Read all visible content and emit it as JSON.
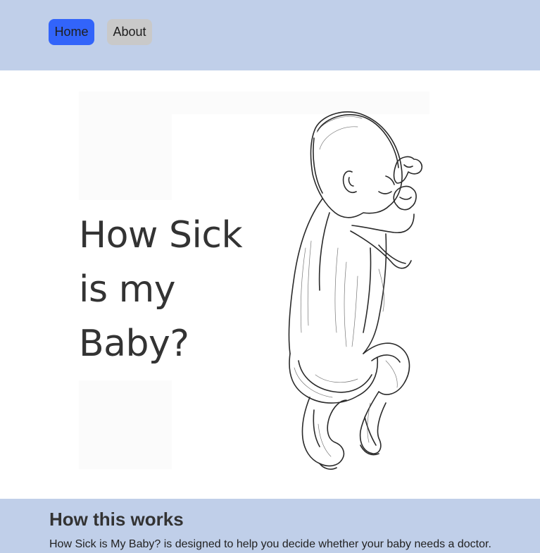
{
  "nav": {
    "home_label": "Home",
    "about_label": "About",
    "active_color": "#3264fa",
    "background": "#c0cfe9"
  },
  "hero": {
    "title_lines": [
      "How Sick",
      "is my",
      "Baby?"
    ],
    "illustration": "sleeping-baby-sketch"
  },
  "how_it_works": {
    "heading": "How this works",
    "body": "How Sick is My Baby? is designed to help you decide whether your baby needs a doctor."
  }
}
